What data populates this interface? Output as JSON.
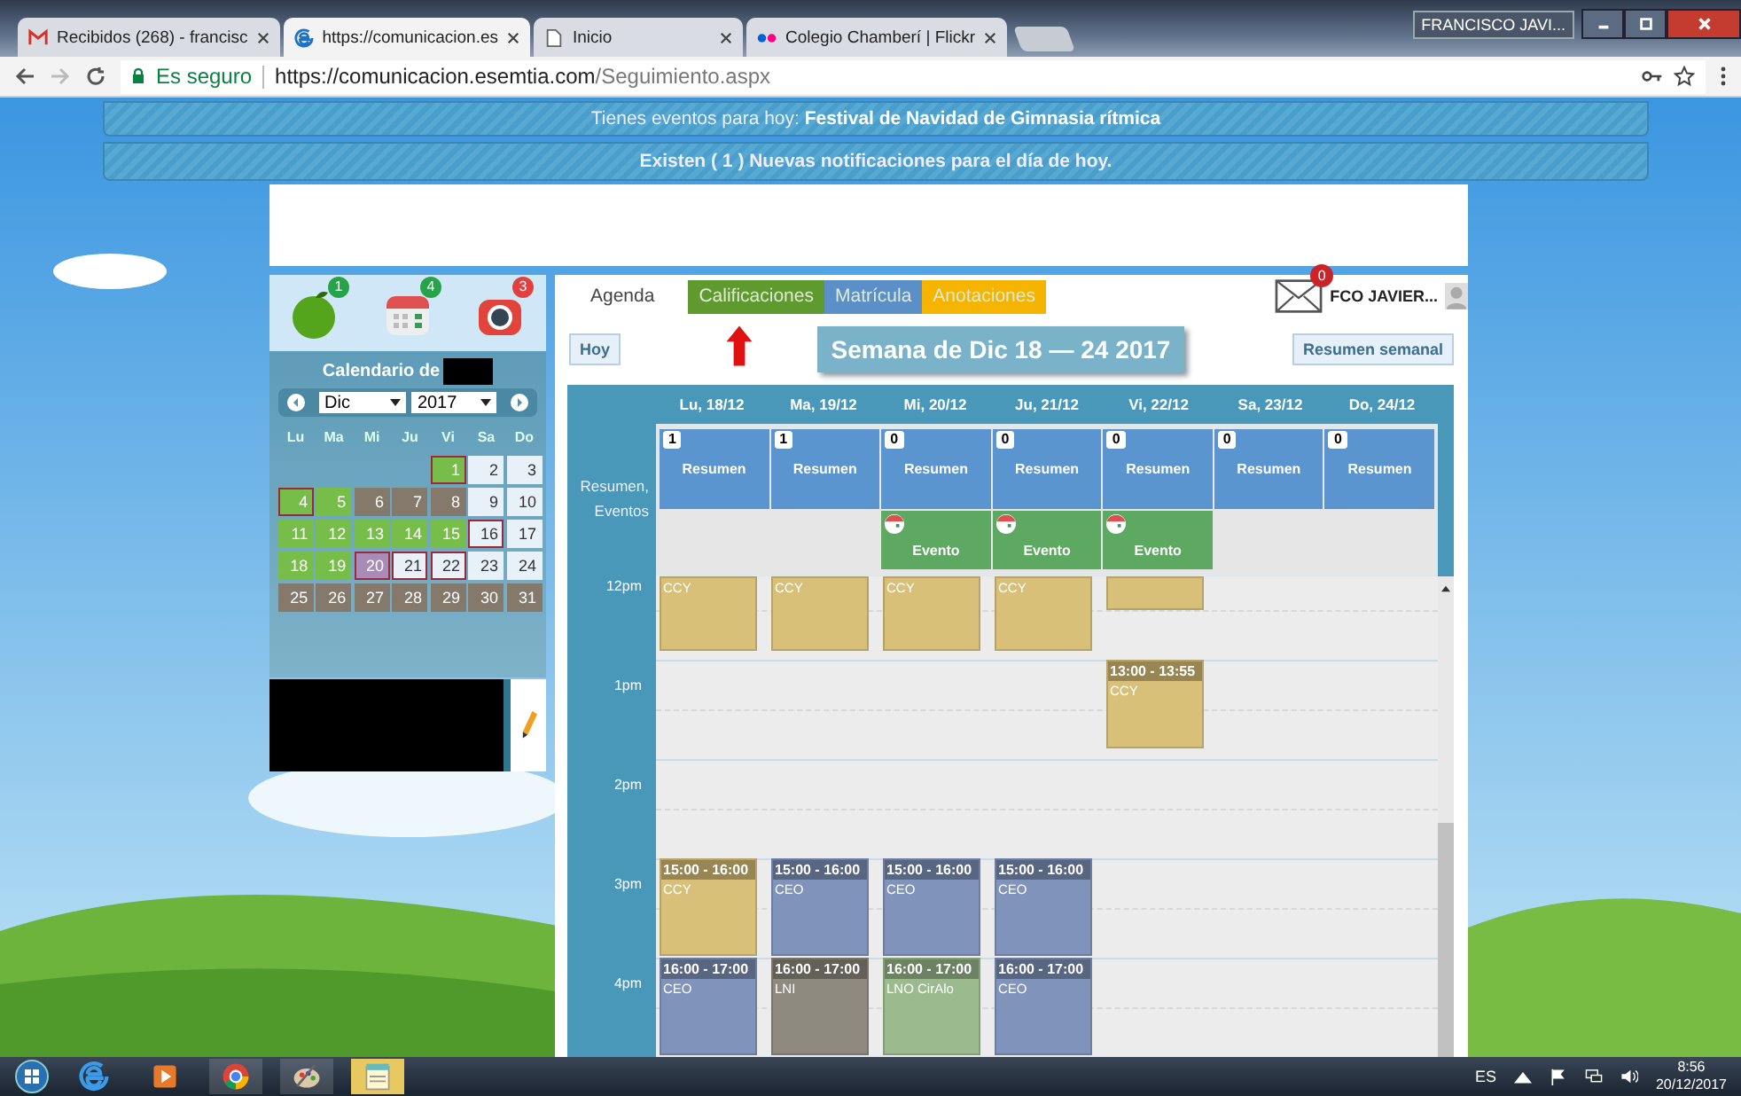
{
  "browser": {
    "tabs": [
      {
        "title": "Recibidos (268) - francisc",
        "kind": "mail",
        "selected": false
      },
      {
        "title": "https://comunicacion.es",
        "kind": "web",
        "selected": true
      },
      {
        "title": "Inicio",
        "kind": "page",
        "selected": false
      },
      {
        "title": "Colegio Chamberí | Flickr",
        "kind": "photos",
        "selected": false
      }
    ],
    "user": "FRANCISCO JAVI...",
    "security": "Es seguro",
    "url_host": "https://comunicacion.esemtia.com",
    "url_path": "/Seguimiento.aspx"
  },
  "banners": [
    {
      "text": "Tienes eventos para hoy: **Festival de Navidad de Gimnasia rítmica**",
      "bold": false
    },
    {
      "text": "Existen ( 1 ) Nuevas notificaciones para el día de hoy.",
      "bold": true
    }
  ],
  "side": {
    "shortcuts": [
      {
        "kind": "apple",
        "count": "1"
      },
      {
        "kind": "calendar",
        "count": "4"
      },
      {
        "kind": "camera",
        "count": "3"
      }
    ],
    "title": "Calendario de",
    "month": "Dic",
    "year": "2017",
    "weekdays": [
      "Lu",
      "Ma",
      "Mi",
      "Ju",
      "Vi",
      "Sa",
      "Do"
    ],
    "weeks": [
      [
        {
          "kind": "empty"
        },
        {
          "kind": "empty"
        },
        {
          "kind": "empty"
        },
        {
          "kind": "empty"
        },
        {
          "day": "1",
          "kind": "green",
          "marked": true
        },
        {
          "day": "2",
          "kind": "light",
          "marked": false
        },
        {
          "day": "3",
          "kind": "light",
          "marked": false
        }
      ],
      [
        {
          "day": "4",
          "kind": "green",
          "marked": true
        },
        {
          "day": "5",
          "kind": "green",
          "marked": false
        },
        {
          "day": "6",
          "kind": "gray",
          "marked": false
        },
        {
          "day": "7",
          "kind": "gray",
          "marked": false
        },
        {
          "day": "8",
          "kind": "gray",
          "marked": false
        },
        {
          "day": "9",
          "kind": "light",
          "marked": false
        },
        {
          "day": "10",
          "kind": "light",
          "marked": false
        }
      ],
      [
        {
          "day": "11",
          "kind": "green",
          "marked": false
        },
        {
          "day": "12",
          "kind": "green",
          "marked": false
        },
        {
          "day": "13",
          "kind": "green",
          "marked": false
        },
        {
          "day": "14",
          "kind": "green",
          "marked": false
        },
        {
          "day": "15",
          "kind": "green",
          "marked": false
        },
        {
          "day": "16",
          "kind": "light",
          "marked": true
        },
        {
          "day": "17",
          "kind": "light",
          "marked": false
        }
      ],
      [
        {
          "day": "18",
          "kind": "green",
          "marked": false
        },
        {
          "day": "19",
          "kind": "green",
          "marked": false
        },
        {
          "day": "20",
          "kind": "today",
          "marked": true
        },
        {
          "day": "21",
          "kind": "light",
          "marked": true
        },
        {
          "day": "22",
          "kind": "light",
          "marked": true
        },
        {
          "day": "23",
          "kind": "light",
          "marked": false
        },
        {
          "day": "24",
          "kind": "light",
          "marked": false
        }
      ],
      [
        {
          "day": "25",
          "kind": "gray",
          "marked": false
        },
        {
          "day": "26",
          "kind": "gray",
          "marked": false
        },
        {
          "day": "27",
          "kind": "gray",
          "marked": false
        },
        {
          "day": "28",
          "kind": "gray",
          "marked": false
        },
        {
          "day": "29",
          "kind": "gray",
          "marked": false
        },
        {
          "day": "30",
          "kind": "gray",
          "marked": false
        },
        {
          "day": "31",
          "kind": "gray",
          "marked": false
        }
      ]
    ]
  },
  "tabs": [
    {
      "label": "Agenda",
      "selected": true
    },
    {
      "label": "Calificaciones",
      "selected": false,
      "color": "#5f9a2e"
    },
    {
      "label": "Matrícula",
      "selected": false,
      "color": "#5b8fc8"
    },
    {
      "label": "Anotaciones",
      "selected": false,
      "color": "#f5b400"
    }
  ],
  "mail_count": "0",
  "user": "FCO JAVIER...",
  "today_button": "Hoy",
  "week_title": "Semana de Dic 18 — 24 2017",
  "summary_button": "Resumen semanal",
  "schedule": {
    "summary_label": "Resumen, Eventos",
    "hours": [
      "12pm",
      "1pm",
      "2pm",
      "3pm",
      "4pm"
    ],
    "days": [
      {
        "header": "Lu, 18/12",
        "count": "1",
        "summary": "Resumen",
        "entries": [
          {
            "kind": "continued",
            "title": "CCY",
            "color": "#d8c079"
          },
          {
            "kind": "timed",
            "time": "15:00 - 16:00",
            "title": "CCY",
            "color": "#d8c079"
          },
          {
            "kind": "timed",
            "time": "16:00 - 17:00",
            "title": "CEO",
            "color": "#7f93bb"
          }
        ]
      },
      {
        "header": "Ma, 19/12",
        "count": "1",
        "summary": "Resumen",
        "entries": [
          {
            "kind": "continued",
            "title": "CCY",
            "color": "#d8c079"
          },
          {
            "kind": "timed",
            "time": "15:00 - 16:00",
            "title": "CEO",
            "color": "#7f93bb"
          },
          {
            "kind": "timed",
            "time": "16:00 - 17:00",
            "title": "LNI",
            "color": "#8e8a7f"
          }
        ]
      },
      {
        "header": "Mi, 20/12",
        "count": "0",
        "summary": "Resumen",
        "event": "Evento",
        "entries": [
          {
            "kind": "continued",
            "title": "CCY",
            "color": "#d8c079"
          },
          {
            "kind": "timed",
            "time": "15:00 - 16:00",
            "title": "CEO",
            "color": "#7f93bb"
          },
          {
            "kind": "timed",
            "time": "16:00 - 17:00",
            "title": "LNO CirAlo",
            "color": "#9bbb8e"
          }
        ]
      },
      {
        "header": "Ju, 21/12",
        "count": "0",
        "summary": "Resumen",
        "event": "Evento",
        "entries": [
          {
            "kind": "continued",
            "title": "CCY",
            "color": "#d8c079"
          },
          {
            "kind": "timed",
            "time": "15:00 - 16:00",
            "title": "CEO",
            "color": "#7f93bb"
          },
          {
            "kind": "timed",
            "time": "16:00 - 17:00",
            "title": "CEO",
            "color": "#7f93bb"
          }
        ]
      },
      {
        "header": "Vi, 22/12",
        "count": "0",
        "summary": "Resumen",
        "event": "Evento",
        "entries": [
          {
            "kind": "continued_short",
            "color": "#d8c079"
          },
          {
            "kind": "timed",
            "time": "13:00 - 13:55",
            "title": "CCY",
            "color": "#d8c079"
          }
        ]
      },
      {
        "header": "Sa, 23/12",
        "count": "0",
        "summary": "Resumen"
      },
      {
        "header": "Do, 24/12",
        "count": "0",
        "summary": "Resumen"
      }
    ]
  },
  "taskbar": {
    "language": "ES",
    "time": "8:56",
    "date": "20/12/2017"
  }
}
